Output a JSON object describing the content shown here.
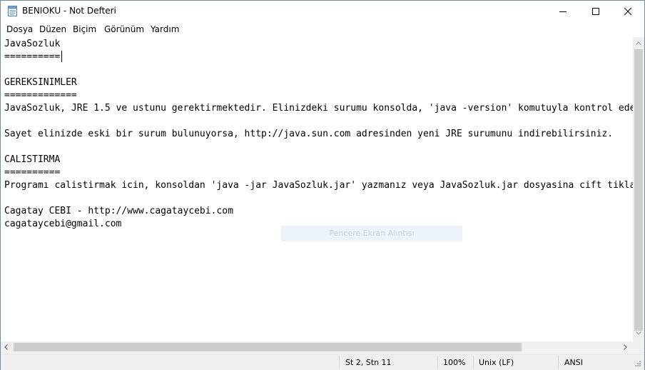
{
  "window": {
    "title": "BENIOKU - Not Defteri",
    "icon": "notepad-icon",
    "controls": [
      "minimize-icon",
      "maximize-icon",
      "close-icon"
    ]
  },
  "menu": {
    "items": [
      {
        "label": "Dosya"
      },
      {
        "label": "Düzen"
      },
      {
        "label": "Biçim"
      },
      {
        "label": "Görünüm"
      },
      {
        "label": "Yardım"
      }
    ]
  },
  "document": {
    "lines": [
      "JavaSozluk",
      "==========",
      "",
      "GEREKSINIMLER",
      "=============",
      "JavaSozluk, JRE 1.5 ve ustunu gerektirmektedir. Elinizdeki surumu konsolda, 'java -version' komutuyla kontrol edebilirsiniz.",
      "",
      "Sayet elinizde eski bir surum bulunuyorsa, http://java.sun.com adresinden yeni JRE surumunu indirebilirsiniz.",
      "",
      "CALISTIRMA",
      "==========",
      "Programı calistirmak icin, konsoldan 'java -jar JavaSozluk.jar' yazmanız veya JavaSozluk.jar dosyasina cift tiklamaniz yeterlidir.",
      "",
      "Cagatay CEBI - http://www.cagataycebi.com",
      "cagataycebi@gmail.com"
    ]
  },
  "overlay": {
    "label": "Pencere Ekran Alıntısı"
  },
  "status": {
    "position": "St 2, Stn 11",
    "zoom": "100%",
    "line_endings": "Unix (LF)",
    "encoding": "ANSI"
  }
}
